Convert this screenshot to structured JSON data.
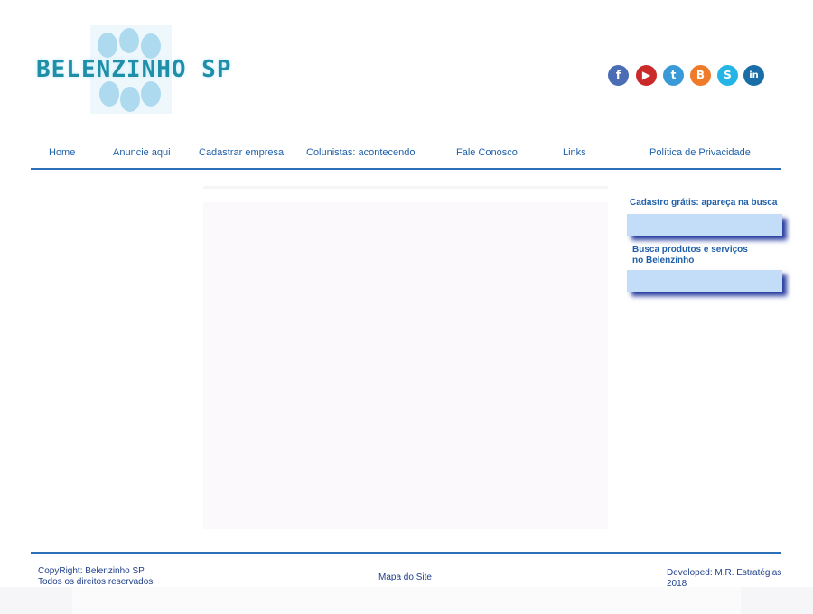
{
  "brand": {
    "logo_text": "BELENZINHO SP"
  },
  "social": [
    {
      "name": "facebook-icon",
      "glyph": "f",
      "color": "#4a6db4"
    },
    {
      "name": "youtube-icon",
      "glyph": "▶",
      "color": "#cc2a2a"
    },
    {
      "name": "twitter-icon",
      "glyph": "t",
      "color": "#3a9ad8"
    },
    {
      "name": "blogger-icon",
      "glyph": "B",
      "color": "#ee7a2a"
    },
    {
      "name": "skype-icon",
      "glyph": "S",
      "color": "#25b4e6"
    },
    {
      "name": "linkedin-icon",
      "glyph": "in",
      "color": "#1a6ea8"
    }
  ],
  "nav": {
    "home": "Home",
    "anuncie": "Anuncie aqui",
    "cadastrar": "Cadastrar empresa",
    "colunistas": "Colunistas: acontecendo",
    "fale": "Fale Conosco",
    "links": "Links",
    "politica": "Política de Privacidade"
  },
  "sidebar": {
    "cadastro_title": "Cadastro grátis: apareça na busca",
    "busca_title_line1": "Busca produtos e serviços",
    "busca_title_line2": "no Belenzinho"
  },
  "footer": {
    "copyright_line1": "CopyRight: Belenzinho SP",
    "copyright_line2": "Todos os direitos reservados",
    "sitemap": "Mapa do Site",
    "developed_line1": "Developed: M.R. Estratégias",
    "developed_line2": "2018"
  },
  "colors": {
    "accent": "#2a6fb8",
    "link": "#1f5fa8",
    "box": "#c3dcf8"
  }
}
